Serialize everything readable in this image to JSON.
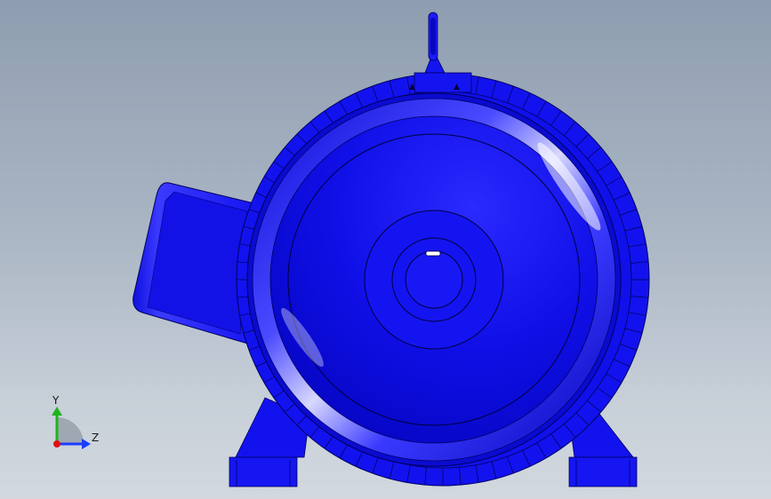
{
  "viewport": {
    "background_top": "#8e9db0",
    "background_bottom": "#d2d8de"
  },
  "model": {
    "body_color": "#1414f0",
    "dark_color": "#0000b0",
    "highlight_color": "#6b6bff"
  },
  "triad": {
    "y_label": "Y",
    "z_label": "Z",
    "y_color": "#1db41d",
    "z_color": "#1a3cff",
    "x_color": "#e01010"
  }
}
